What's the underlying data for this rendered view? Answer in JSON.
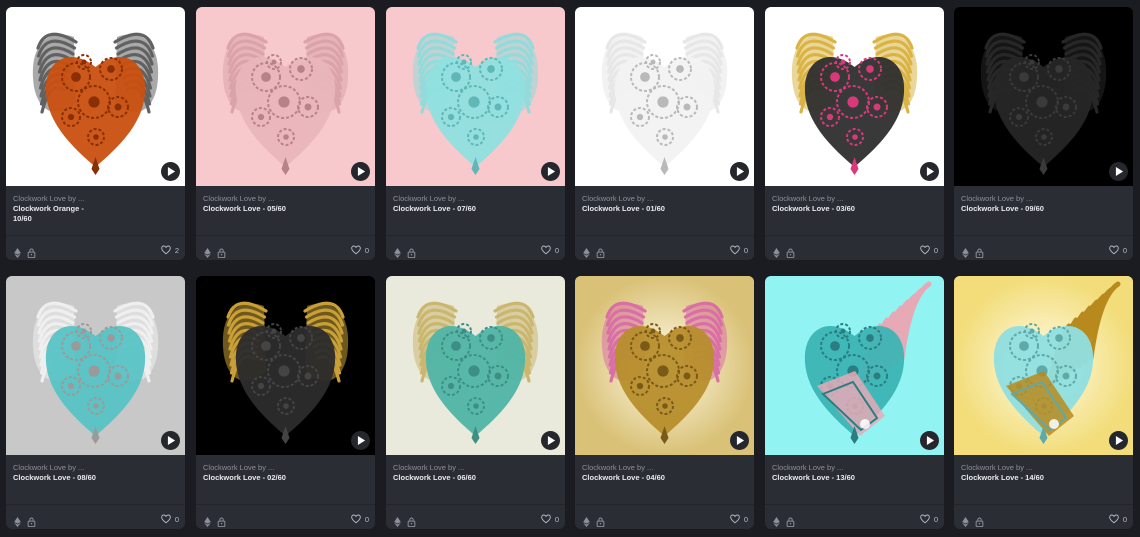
{
  "cards": [
    {
      "collection": "Clockwork Love by ...",
      "title": "Clockwork Orange - 10/60",
      "likes": "2",
      "bg": "#ffffff",
      "body": "#c9500f",
      "wing": "#5a5a5a",
      "detail": "#8a2f05",
      "gold": false,
      "style": "wings"
    },
    {
      "collection": "Clockwork Love by ...",
      "title": "Clockwork Love - 05/60",
      "likes": "0",
      "bg": "#f7c8cc",
      "body": "#e9b6ba",
      "wing": "#d9a3a8",
      "detail": "#b88289",
      "gold": false,
      "style": "wings"
    },
    {
      "collection": "Clockwork Love by ...",
      "title": "Clockwork Love - 07/60",
      "likes": "0",
      "bg": "#f7c8cc",
      "body": "#8fe0df",
      "wing": "#8fdcdb",
      "detail": "#5fb7b6",
      "gold": false,
      "style": "wings"
    },
    {
      "collection": "Clockwork Love by ...",
      "title": "Clockwork Love - 01/60",
      "likes": "0",
      "bg": "#ffffff",
      "body": "#f2f2f2",
      "wing": "#e6e6e6",
      "detail": "#b9b9b9",
      "gold": false,
      "style": "wings"
    },
    {
      "collection": "Clockwork Love by ...",
      "title": "Clockwork Love - 03/60",
      "likes": "0",
      "bg": "#ffffff",
      "body": "#2e2e2e",
      "wing": "#d8b03c",
      "detail": "#d9397a",
      "gold": true,
      "style": "wings"
    },
    {
      "collection": "Clockwork Love by ...",
      "title": "Clockwork Love - 09/60",
      "likes": "0",
      "bg": "#000000",
      "body": "#262626",
      "wing": "#2a2a2a",
      "detail": "#3a3a3a",
      "gold": false,
      "style": "wings"
    },
    {
      "collection": "Clockwork Love by ...",
      "title": "Clockwork Love - 08/60",
      "likes": "0",
      "bg": "#c8c8c8",
      "body": "#58c3c4",
      "wing": "#f2f2f2",
      "detail": "#9a9a9a",
      "gold": false,
      "style": "wings"
    },
    {
      "collection": "Clockwork Love by ...",
      "title": "Clockwork Love - 02/60",
      "likes": "0",
      "bg": "#000000",
      "body": "#2c2c2c",
      "wing": "#d4a93a",
      "detail": "#444444",
      "gold": true,
      "style": "wings"
    },
    {
      "collection": "Clockwork Love by ...",
      "title": "Clockwork Love - 06/60",
      "likes": "0",
      "bg": "#e9eadb",
      "body": "#4fb5a8",
      "wing": "#c9b46a",
      "detail": "#3d8e84",
      "gold": true,
      "style": "wings"
    },
    {
      "collection": "Clockwork Love by ...",
      "title": "Clockwork Love - 04/60",
      "likes": "0",
      "bg": "#d9c177",
      "body": "#b78e2c",
      "wing": "#d96aa5",
      "detail": "#7a5a18",
      "gold": true,
      "style": "wings"
    },
    {
      "collection": "Clockwork Love by ...",
      "title": "Clockwork Love - 13/60",
      "likes": "0",
      "bg": "#92f3f3",
      "body": "#3db4b4",
      "wing": "#e7a9b6",
      "detail": "#2a7d80",
      "gold": false,
      "style": "flame"
    },
    {
      "collection": "Clockwork Love by ...",
      "title": "Clockwork Love - 14/60",
      "likes": "0",
      "bg": "#f2dd7a",
      "body": "#8fdfe0",
      "wing": "#b88a1e",
      "detail": "#5ea9aa",
      "gold": true,
      "style": "flame"
    }
  ]
}
